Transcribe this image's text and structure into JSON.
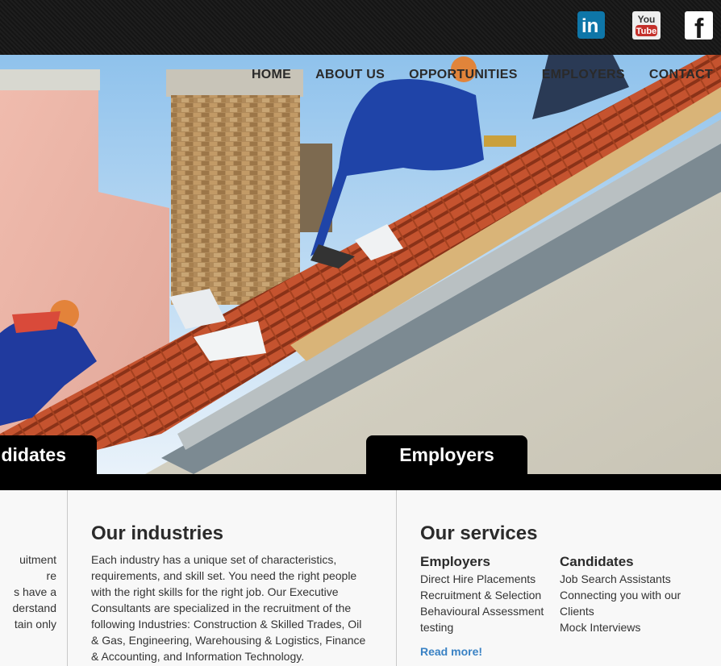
{
  "social": {
    "linkedin_text": "in",
    "youtube_top": "You",
    "youtube_bottom": "Tube",
    "facebook_text": "f"
  },
  "nav": [
    "HOME",
    "ABOUT US",
    "OPPORTUNITIES",
    "EMPLOYERS",
    "CONTACT"
  ],
  "hero_tabs": {
    "candidates": "ndidates",
    "employers": "Employers"
  },
  "left_column_fragments": [
    "uitment",
    "re",
    "s have a",
    "derstand",
    "tain only"
  ],
  "industries": {
    "title": "Our industries",
    "lines": [
      "Each industry has a unique set of characteristics,",
      "requirements, and skill set. You need the right people",
      "with the right skills for the right job. Our Executive",
      "Consultants are specialized in the recruitment of the",
      "following Industries: Construction & Skilled Trades, Oil",
      "& Gas, Engineering, Warehousing & Logistics, Finance",
      "& Accounting, and Information Technology."
    ]
  },
  "services": {
    "title": "Our services",
    "employers": {
      "heading": "Employers",
      "items": [
        "Direct Hire Placements",
        "Recruitment & Selection",
        "Behavioural Assessment",
        "testing"
      ]
    },
    "candidates": {
      "heading": "Candidates",
      "items": [
        "Job Search Assistants",
        "Connecting you with our",
        "Clients",
        "Mock Interviews"
      ]
    },
    "read_more": "Read more!"
  },
  "colors": {
    "topbar": "#1a1a1a",
    "link": "#3a82c4",
    "tab": "#000000"
  }
}
